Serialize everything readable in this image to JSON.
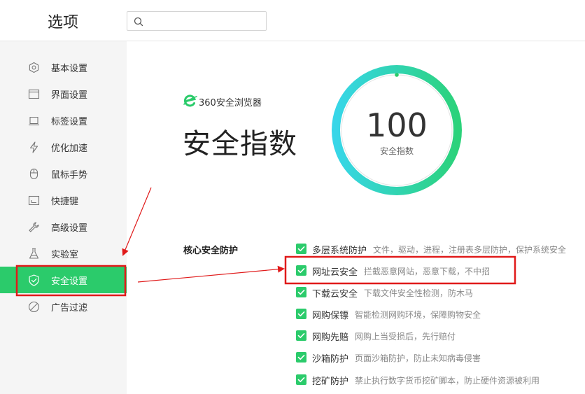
{
  "header": {
    "title": "选项",
    "search": {
      "value": "",
      "placeholder": ""
    }
  },
  "sidebar": {
    "items": [
      {
        "label": "基本设置",
        "icon": "gear-icon",
        "active": false
      },
      {
        "label": "界面设置",
        "icon": "window-icon",
        "active": false
      },
      {
        "label": "标签设置",
        "icon": "tab-icon",
        "active": false
      },
      {
        "label": "优化加速",
        "icon": "lightning-icon",
        "active": false
      },
      {
        "label": "鼠标手势",
        "icon": "mouse-icon",
        "active": false
      },
      {
        "label": "快捷键",
        "icon": "keyboard-icon",
        "active": false
      },
      {
        "label": "高级设置",
        "icon": "wrench-icon",
        "active": false
      },
      {
        "label": "实验室",
        "icon": "flask-icon",
        "active": false
      },
      {
        "label": "安全设置",
        "icon": "shield-check-icon",
        "active": true
      },
      {
        "label": "广告过滤",
        "icon": "block-icon",
        "active": false
      }
    ]
  },
  "main": {
    "brand": "360安全浏览器",
    "title": "安全指数",
    "score": "100",
    "score_label": "安全指数",
    "score_fraction": 1.0,
    "section_title": "核心安全防护",
    "features": [
      {
        "name": "多层系统防护",
        "desc": "文件，驱动，进程，注册表多层防护，保护系统安全",
        "checked": true
      },
      {
        "name": "网址云安全",
        "desc": "拦截恶意网站，恶意下载，不中招",
        "checked": true
      },
      {
        "name": "下载云安全",
        "desc": "下载文件安全性检测，防木马",
        "checked": true
      },
      {
        "name": "网购保镖",
        "desc": "智能检测网购环境，保障购物安全",
        "checked": true
      },
      {
        "name": "网购先赔",
        "desc": "网购上当受损后，先行赔付",
        "checked": true
      },
      {
        "name": "沙箱防护",
        "desc": "页面沙箱防护，防止未知病毒侵害",
        "checked": true
      },
      {
        "name": "挖矿防护",
        "desc": "禁止执行数字货币挖矿脚本，防止硬件资源被利用",
        "checked": true
      }
    ]
  },
  "colors": {
    "accent": "#2bcb6b",
    "annotation": "#e01a1a",
    "gauge_start": "#37d6e8",
    "gauge_end": "#2bd27a"
  }
}
